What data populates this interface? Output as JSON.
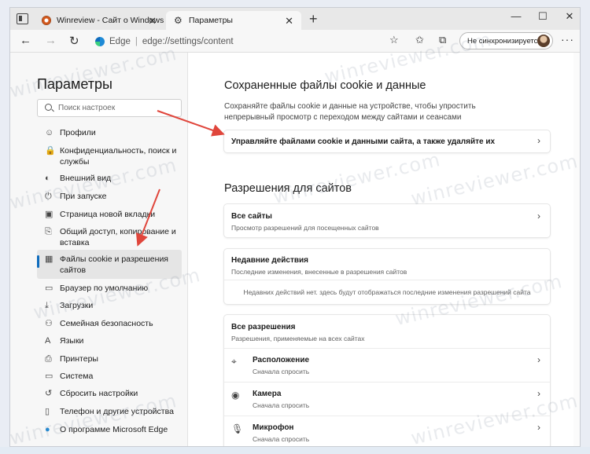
{
  "browser": {
    "tabs": [
      {
        "title": "Winreview - Сайт о Windows",
        "active": false
      },
      {
        "title": "Параметры",
        "active": true
      }
    ],
    "new_tab_icon": "+",
    "window_controls": [
      "—",
      "☐",
      "✕"
    ],
    "address": {
      "brand": "Edge",
      "separator": "|",
      "url": "edge://settings/content"
    },
    "sync_label": "Не синхронизируется",
    "more_icon": "···"
  },
  "sidebar": {
    "title": "Параметры",
    "search_placeholder": "Поиск настроек",
    "items": [
      {
        "label": "Профили",
        "icon": "profile-icon",
        "glyph": "☺"
      },
      {
        "label": "Конфиденциальность, поиск и службы",
        "icon": "lock-icon",
        "glyph": "🔒"
      },
      {
        "label": "Внешний вид",
        "icon": "appearance-icon",
        "glyph": "◐"
      },
      {
        "label": "При запуске",
        "icon": "power-icon",
        "glyph": "⏻"
      },
      {
        "label": "Страница новой вкладки",
        "icon": "new-tab-page-icon",
        "glyph": "▣"
      },
      {
        "label": "Общий доступ, копирование и вставка",
        "icon": "share-icon",
        "glyph": "⎘"
      },
      {
        "label": "Файлы cookie и разрешения сайтов",
        "icon": "cookie-icon",
        "glyph": "▦",
        "active": true
      },
      {
        "label": "Браузер по умолчанию",
        "icon": "default-browser-icon",
        "glyph": "▭"
      },
      {
        "label": "Загрузки",
        "icon": "download-icon",
        "glyph": "⤓"
      },
      {
        "label": "Семейная безопасность",
        "icon": "family-icon",
        "glyph": "⚇"
      },
      {
        "label": "Языки",
        "icon": "languages-icon",
        "glyph": "A"
      },
      {
        "label": "Принтеры",
        "icon": "printer-icon",
        "glyph": "⎙"
      },
      {
        "label": "Система",
        "icon": "system-icon",
        "glyph": "▭"
      },
      {
        "label": "Сбросить настройки",
        "icon": "reset-icon",
        "glyph": "↺"
      },
      {
        "label": "Телефон и другие устройства",
        "icon": "phone-icon",
        "glyph": "▯"
      },
      {
        "label": "О программе Microsoft Edge",
        "icon": "edge-logo-icon",
        "glyph": "●"
      }
    ]
  },
  "main": {
    "cookies_section": {
      "heading": "Сохраненные файлы cookie и данные",
      "description": "Сохраняйте файлы cookie и данные на устройстве, чтобы упростить непрерывный просмотр с переходом между сайтами и сеансами",
      "manage_label": "Управляйте файлами cookie и данными сайта, а также удаляйте их"
    },
    "permissions_section": {
      "heading": "Разрешения для сайтов",
      "all_sites": {
        "title": "Все сайты",
        "subtitle": "Просмотр разрешений для посещенных сайтов"
      },
      "recent": {
        "title": "Недавние действия",
        "subtitle": "Последние изменения, внесенные в разрешения сайтов",
        "empty_message": "Недавних действий нет. здесь будут отображаться последние изменения разрешений сайта"
      },
      "all_permissions": {
        "title": "Все разрешения",
        "subtitle": "Разрешения, применяемые на всех сайтах",
        "items": [
          {
            "title": "Расположение",
            "subtitle": "Сначала спросить",
            "icon": "location-icon",
            "glyph": "⌖"
          },
          {
            "title": "Камера",
            "subtitle": "Сначала спросить",
            "icon": "camera-icon",
            "glyph": "◉"
          },
          {
            "title": "Микрофон",
            "subtitle": "Сначала спросить",
            "icon": "microphone-icon",
            "glyph": "🎙"
          }
        ]
      }
    }
  },
  "watermark_text": "winreviewer.com",
  "colors": {
    "accent": "#0f6cbd",
    "annotation_arrow": "#e0463c"
  }
}
